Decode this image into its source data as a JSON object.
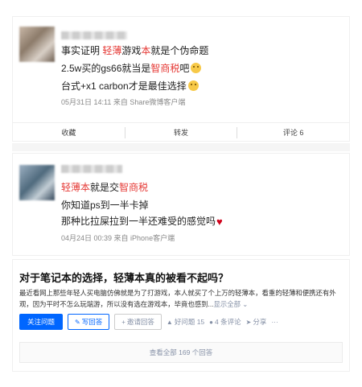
{
  "weibo_posts": [
    {
      "lines": [
        [
          {
            "t": "事实证明 "
          },
          {
            "t": "轻薄",
            "red": true
          },
          {
            "t": "游戏"
          },
          {
            "t": "本",
            "red": true
          },
          {
            "t": "就是个伪命题"
          }
        ],
        [
          {
            "t": "2.5w买的gs66就当是"
          },
          {
            "t": "智商税",
            "red": true
          },
          {
            "t": "吧"
          }
        ],
        [
          {
            "t": "台式+x1 carbon才是最佳选择"
          }
        ]
      ],
      "meta": "05月31日 14:11  来自 Share微博客户端",
      "actions": [
        "收藏",
        "转发",
        "评论 6"
      ]
    },
    {
      "lines": [
        [
          {
            "t": "轻薄本",
            "red": true
          },
          {
            "t": "就是交"
          },
          {
            "t": "智商税",
            "red": true
          }
        ],
        [
          {
            "t": "你知道ps到一半卡掉"
          }
        ],
        [
          {
            "t": "那种比拉屎拉到一半还难受的感觉吗"
          }
        ]
      ],
      "meta": "04月24日 00:39  来自 iPhone客户端"
    }
  ],
  "question": {
    "title": "对于笔记本的选择，轻薄本真的被看不起吗？",
    "description": "最近看网上那些年轻人买电脑仿佛就是为了打游戏，本人就买了个上万的轻薄本，看重的轻薄和便携还有外观，因为平时不怎么玩端游，所以没有选在游戏本，毕竟也感到...",
    "show_all": "显示全部 ⌄",
    "follow_button": "关注问题",
    "answer_button": "写回答",
    "invite_button": "邀请回答",
    "good_question": "好问题 15",
    "comments": "4 条评论",
    "share": "分享",
    "more": "···",
    "view_all": "查看全部 169 个回答"
  },
  "icons": {
    "pencil": "✎",
    "invite": "+",
    "thumb": "▲",
    "comment": "●",
    "share": "➤"
  },
  "colors": {
    "keyword_red": "#e53935",
    "zhihu_blue": "#0066ff"
  }
}
